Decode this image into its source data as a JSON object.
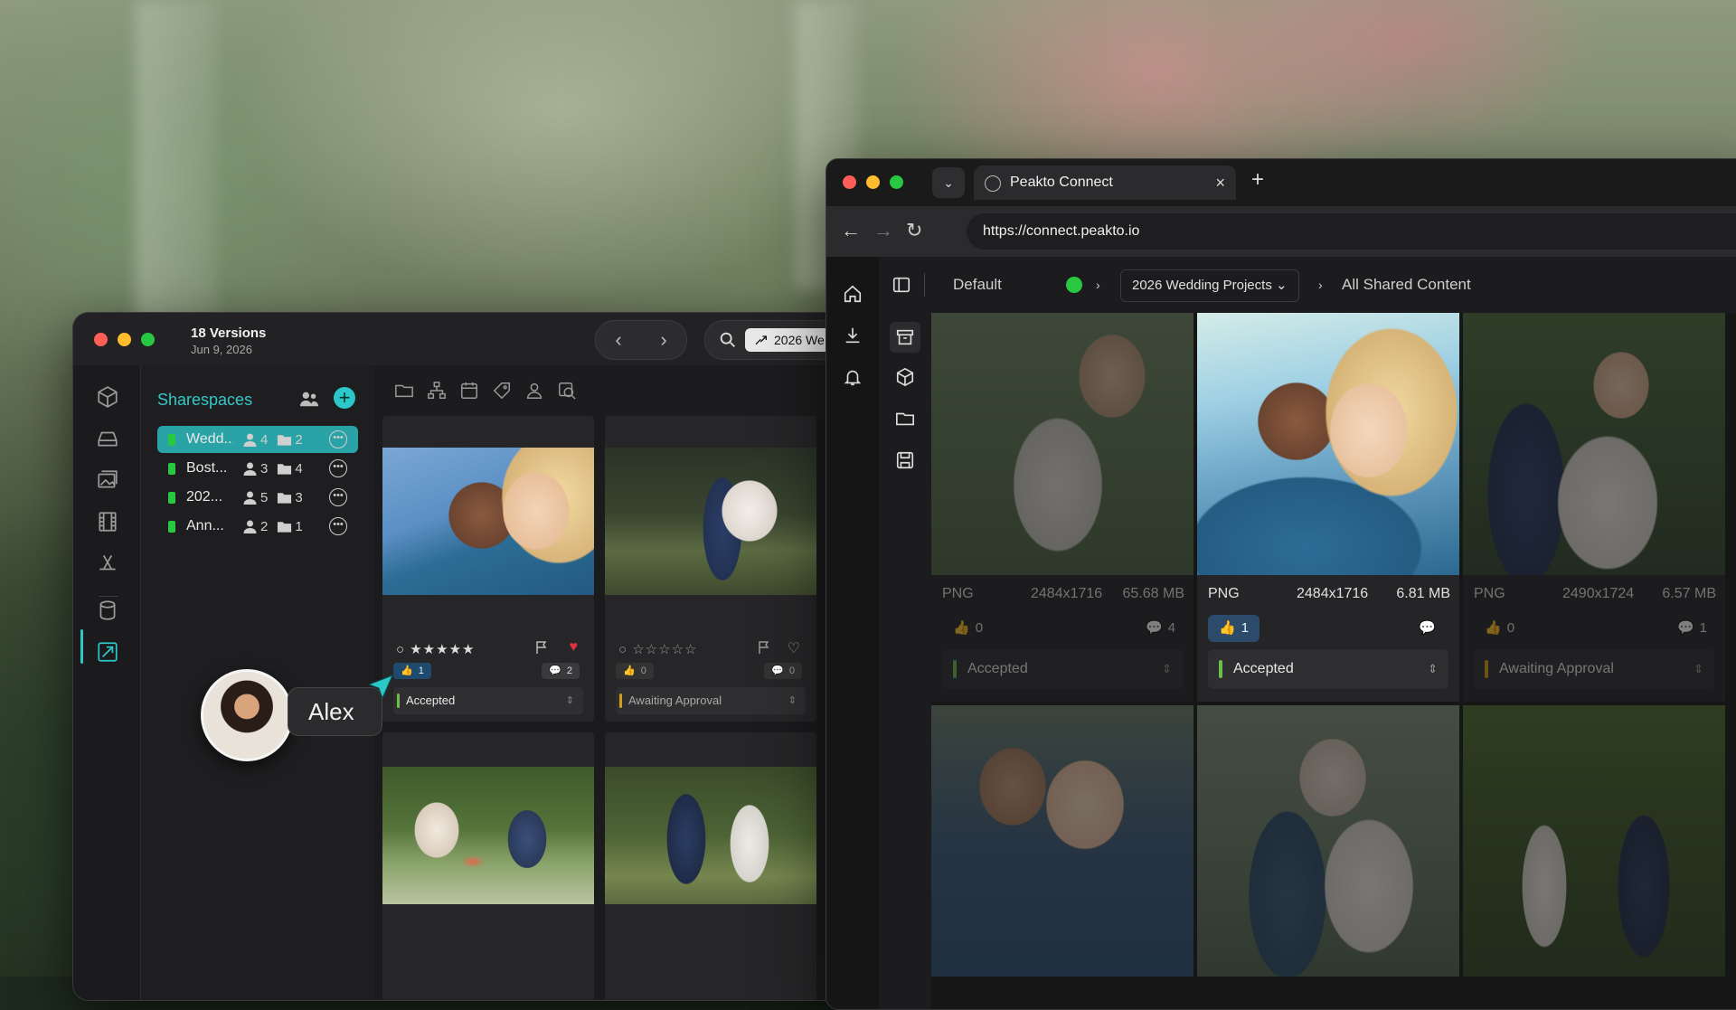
{
  "app": {
    "title": "18 Versions",
    "subtitle": "Jun 9, 2026",
    "search_chip": "2026 We"
  },
  "sharespaces": {
    "title": "Sharespaces",
    "items": [
      {
        "name": "Wedd...",
        "people": "4",
        "folders": "2"
      },
      {
        "name": "Bost...",
        "people": "3",
        "folders": "4"
      },
      {
        "name": "202...",
        "people": "5",
        "folders": "3"
      },
      {
        "name": "Ann...",
        "people": "2",
        "folders": "1"
      }
    ]
  },
  "app_cards": [
    {
      "stars": "★★★★★",
      "likes": "1",
      "comments": "2",
      "status": "Accepted"
    },
    {
      "stars": "☆☆☆☆☆",
      "likes": "0",
      "comments": "0",
      "status": "Awaiting Approval"
    }
  ],
  "collaborator": {
    "name": "Alex"
  },
  "browser": {
    "tab_title": "Peakto Connect",
    "url": "https://connect.peakto.io"
  },
  "peakto": {
    "workspace": "Default",
    "project": "2026 Wedding Projects",
    "section": "All Shared Content",
    "items": [
      {
        "format": "PNG",
        "dims": "2484x1716",
        "size": "65.68 MB",
        "likes": "0",
        "comments": "4",
        "status": "Accepted"
      },
      {
        "format": "PNG",
        "dims": "2484x1716",
        "size": "6.81 MB",
        "likes": "1",
        "comments": "",
        "status": "Accepted"
      },
      {
        "format": "PNG",
        "dims": "2490x1724",
        "size": "6.57 MB",
        "likes": "0",
        "comments": "1",
        "status": "Awaiting Approval"
      }
    ]
  },
  "colors": {
    "accent": "#2cc7c7",
    "accepted": "#6cc04a",
    "awaiting": "#d4a017",
    "heart": "#e0323e"
  }
}
